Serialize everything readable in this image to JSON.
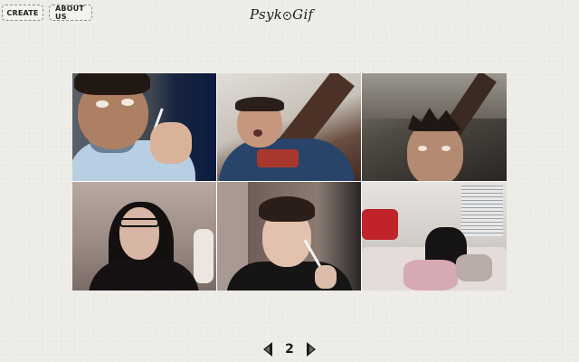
{
  "nav": {
    "create_label": "CREATE",
    "about_label": "ABOUT US"
  },
  "logo": {
    "part1": "Psyk",
    "part2": "Gif"
  },
  "grid": {
    "tiles": [
      {
        "label": ""
      },
      {
        "label": ""
      },
      {
        "label": ""
      },
      {
        "label": ""
      },
      {
        "label": ""
      },
      {
        "label": ""
      }
    ]
  },
  "pager": {
    "current_page": "2",
    "prev_icon": "triangle-left-icon",
    "next_icon": "triangle-right-icon"
  },
  "colors": {
    "background": "#efede8",
    "text": "#222222",
    "border": "#8c8a84"
  }
}
